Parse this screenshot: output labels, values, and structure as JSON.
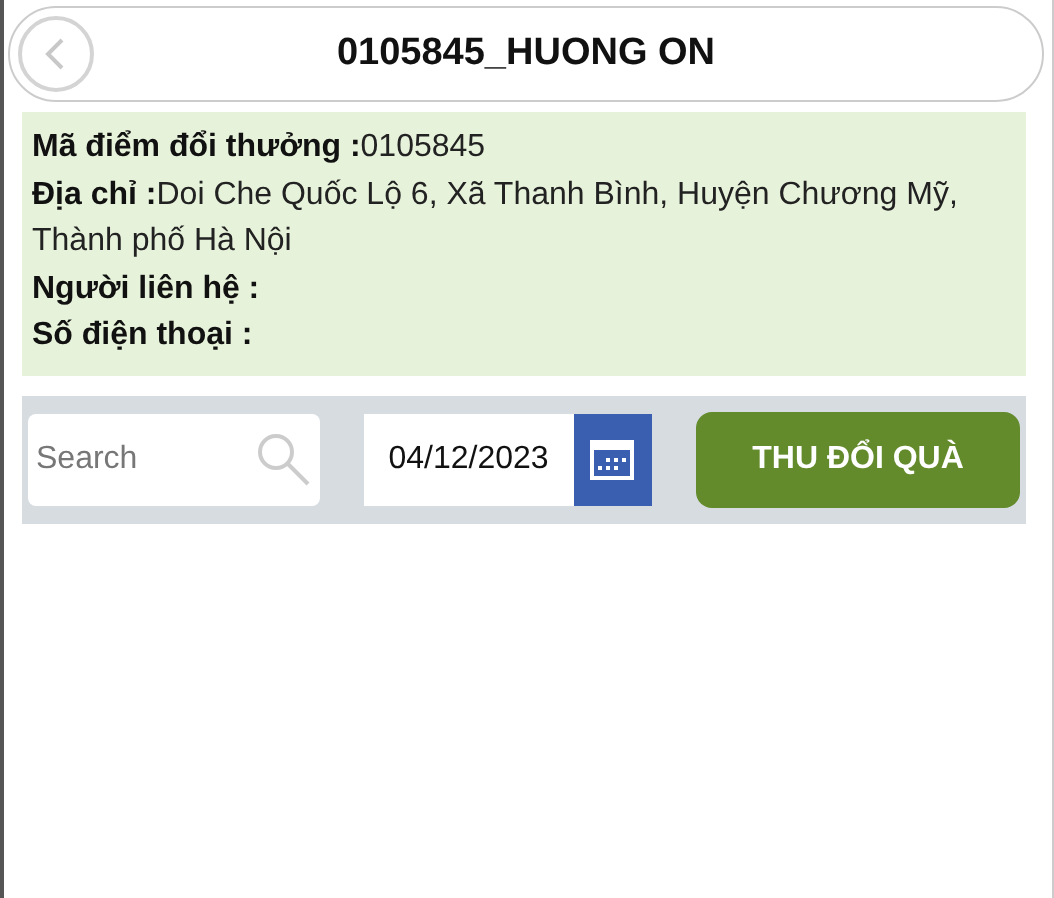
{
  "header": {
    "title": "0105845_HUONG ON"
  },
  "info": [
    {
      "kind": "field",
      "text": "**Mã điểm đổi thưởng :**0105845"
    },
    {
      "kind": "field",
      "text": "**Địa chỉ :**Doi Che Quốc Lộ 6, Xã Thanh Bình, Huyện Chương Mỹ, Thành phố Hà Nội"
    },
    {
      "kind": "empty_field",
      "text": "Người liên hệ :"
    },
    {
      "kind": "empty_field",
      "text": "Số điện thoại :"
    }
  ],
  "toolbar": {
    "search": {
      "placeholder": "Search"
    },
    "date": {
      "value": "04/12/2023"
    },
    "button": "THU ĐỔI QUÀ"
  }
}
